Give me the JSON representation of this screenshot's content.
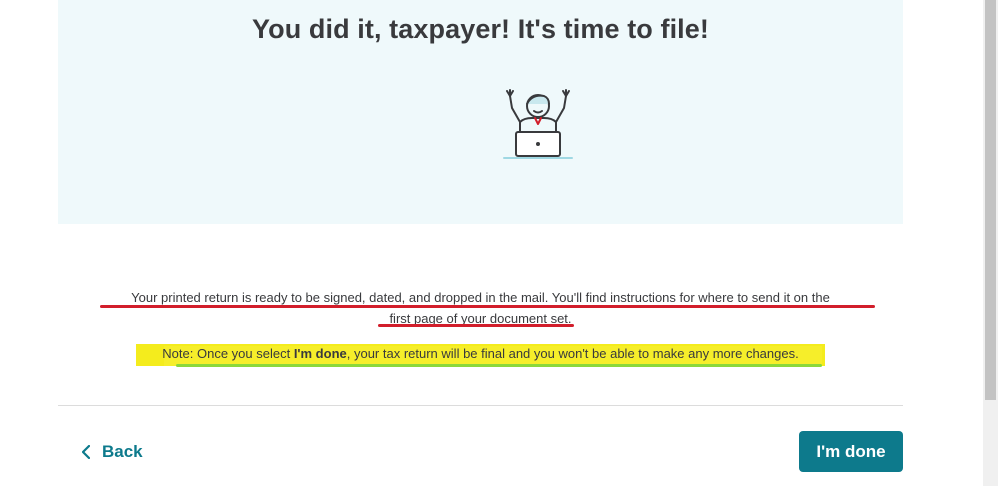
{
  "hero": {
    "title": "You did it, taxpayer! It's time to file!",
    "illustration_icon": "celebrating-person-laptop-icon"
  },
  "message": {
    "line1": "Your printed return is ready to be signed, dated, and dropped in the mail. You'll find instructions for where to send it on the",
    "line2": "first page of your document set."
  },
  "note": {
    "prefix": "Note: Once you select ",
    "emphasis": "I'm done",
    "suffix": ", your tax return will be final and you won't be able to make any more changes."
  },
  "footer": {
    "back_label": "Back",
    "back_icon": "chevron-left-icon",
    "done_label": "I'm done"
  },
  "colors": {
    "accent": "#0d7a8c",
    "hero_background": "#eff9fb",
    "annotation_red": "#d21e2b",
    "annotation_yellow": "#f4ec1d",
    "annotation_green": "#8bd83a"
  }
}
